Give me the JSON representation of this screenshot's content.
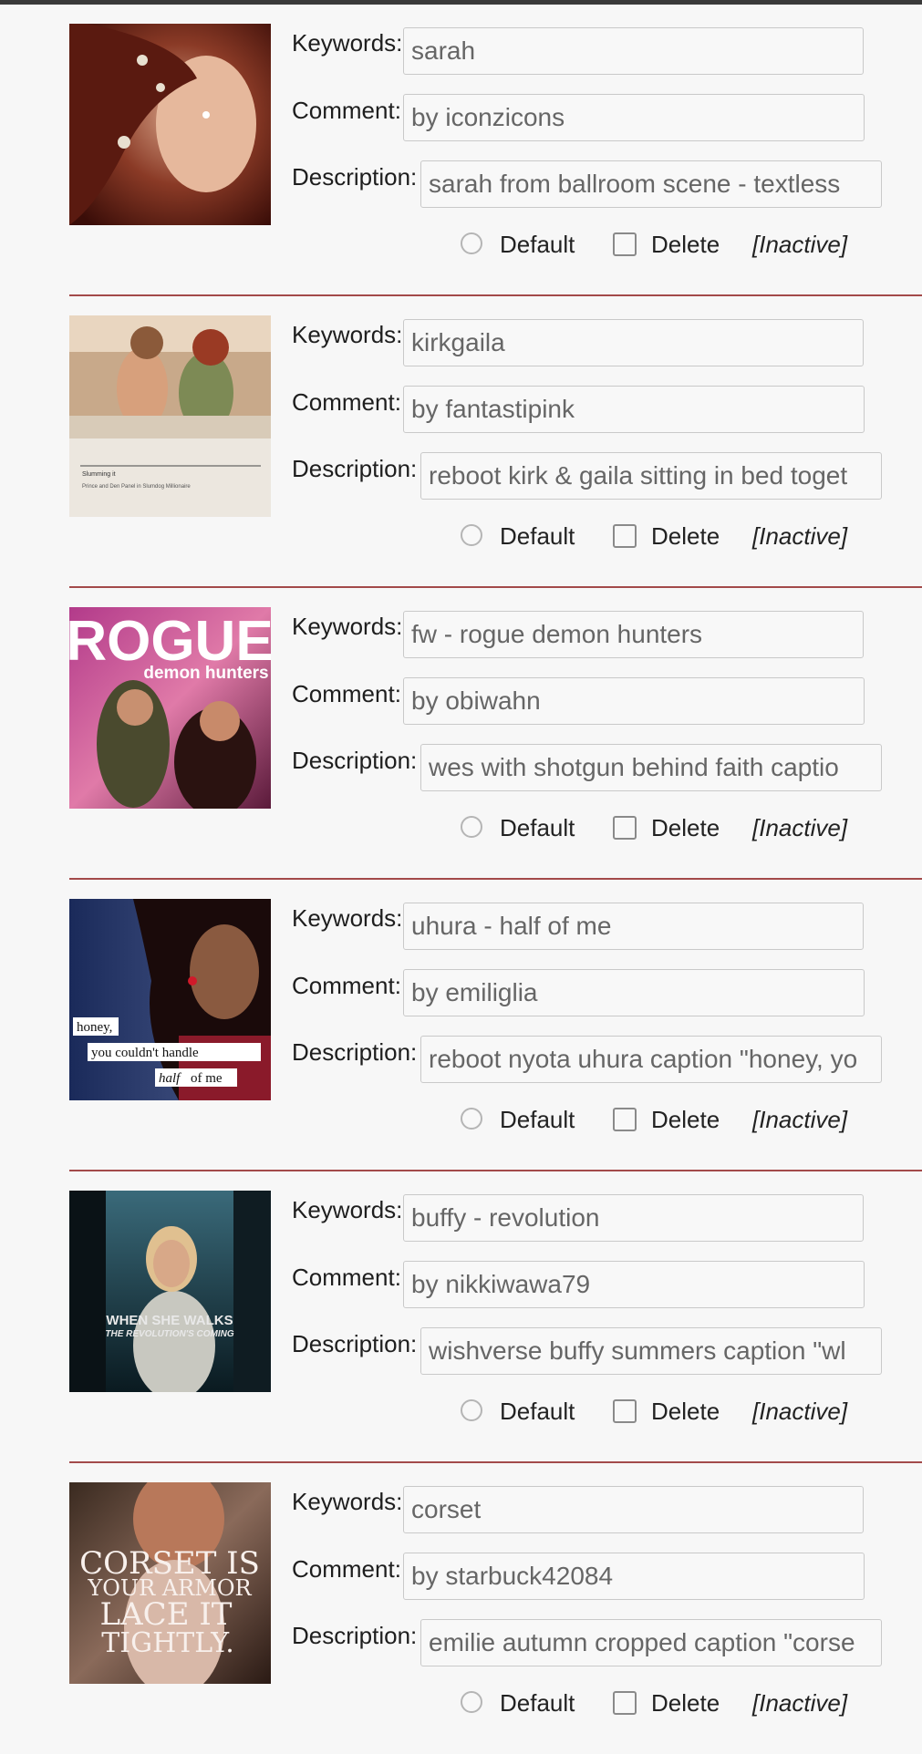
{
  "labels": {
    "keywords": "Keywords:",
    "comment": "Comment:",
    "description": "Description:",
    "default": "Default",
    "delete": "Delete"
  },
  "colors": {
    "divider": "#a34a4a",
    "field_border": "#c9c9c9",
    "field_text": "#666666"
  },
  "entries": [
    {
      "thumbnail": "sarah-ballroom-image",
      "keywords": "sarah",
      "comment": "by iconzicons",
      "description": "sarah from ballroom scene - textless",
      "status": "[Inactive]"
    },
    {
      "thumbnail": "kirk-gaila-image",
      "keywords": "kirkgaila",
      "comment": "by fantastipink",
      "description": "reboot kirk & gaila sitting in bed toget",
      "status": "[Inactive]",
      "image_text": [
        "Slumming it",
        "Prince and Den Panel in Slumdog Millionaire"
      ]
    },
    {
      "thumbnail": "rogue-demon-hunters-image",
      "keywords": "fw - rogue demon hunters",
      "comment": "by obiwahn",
      "description": "wes with shotgun behind faith captio",
      "status": "[Inactive]",
      "image_text": [
        "ROGUE",
        "demon hunters"
      ]
    },
    {
      "thumbnail": "uhura-image",
      "keywords": "uhura - half of me",
      "comment": "by emiliglia",
      "description": "reboot nyota uhura caption \"honey, yo",
      "status": "[Inactive]",
      "image_text": [
        "honey,",
        "you couldn't handle",
        "half",
        "of me"
      ]
    },
    {
      "thumbnail": "buffy-image",
      "keywords": "buffy - revolution",
      "comment": "by nikkiwawa79",
      "description": "wishverse buffy summers caption \"wl",
      "status": "[Inactive]",
      "image_text": [
        "WHEN SHE WALKS",
        "THE REVOLUTION'S COMING"
      ]
    },
    {
      "thumbnail": "corset-image",
      "keywords": "corset",
      "comment": "by starbuck42084",
      "description": "emilie autumn cropped caption \"corse",
      "status": "[Inactive]",
      "image_text": [
        "CORSET IS",
        "YOUR ARMOR",
        "LACE IT",
        "TIGHTLY."
      ]
    }
  ]
}
